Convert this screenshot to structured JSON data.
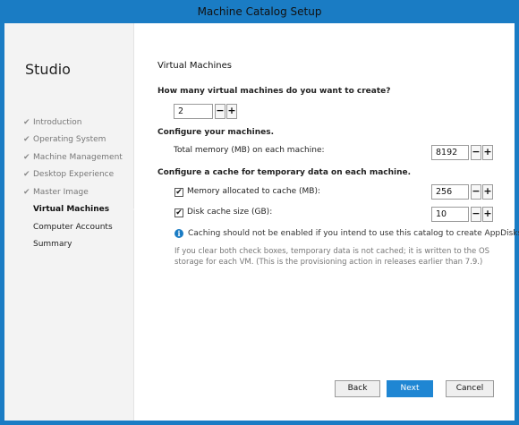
{
  "window": {
    "title": "Machine Catalog Setup"
  },
  "sidebar": {
    "brand": "Studio",
    "steps": [
      {
        "label": "Introduction",
        "state": "done"
      },
      {
        "label": "Operating System",
        "state": "done"
      },
      {
        "label": "Machine Management",
        "state": "done"
      },
      {
        "label": "Desktop Experience",
        "state": "done"
      },
      {
        "label": "Master Image",
        "state": "done"
      },
      {
        "label": "Virtual Machines",
        "state": "active"
      },
      {
        "label": "Computer Accounts",
        "state": "future"
      },
      {
        "label": "Summary",
        "state": "future"
      }
    ]
  },
  "main": {
    "title": "Virtual Machines",
    "vm_count_question": "How many virtual machines do you want to create?",
    "vm_count_value": "2",
    "configure_machines_heading": "Configure your machines.",
    "total_memory_label": "Total memory (MB) on each machine:",
    "total_memory_value": "8192",
    "cache_heading": "Configure a cache for temporary data on each machine.",
    "memory_cache_label": "Memory allocated to cache (MB):",
    "memory_cache_checked": true,
    "memory_cache_value": "256",
    "disk_cache_label": "Disk cache size (GB):",
    "disk_cache_checked": true,
    "disk_cache_value": "10",
    "info_text": "Caching should not be enabled if you intend to use this catalog to create AppDisks.",
    "note_text": "If you clear both check boxes, temporary data is not cached; it is written to the OS storage for each VM. (This is the provisioning action in releases earlier than 7.9.)"
  },
  "spinner": {
    "minus": "−",
    "plus": "+"
  },
  "icons": {
    "check": "✔",
    "info": "i"
  },
  "buttons": {
    "back": "Back",
    "next": "Next",
    "cancel": "Cancel"
  },
  "colors": {
    "accent": "#1a7cc4",
    "primary_button": "#1f86d3"
  }
}
